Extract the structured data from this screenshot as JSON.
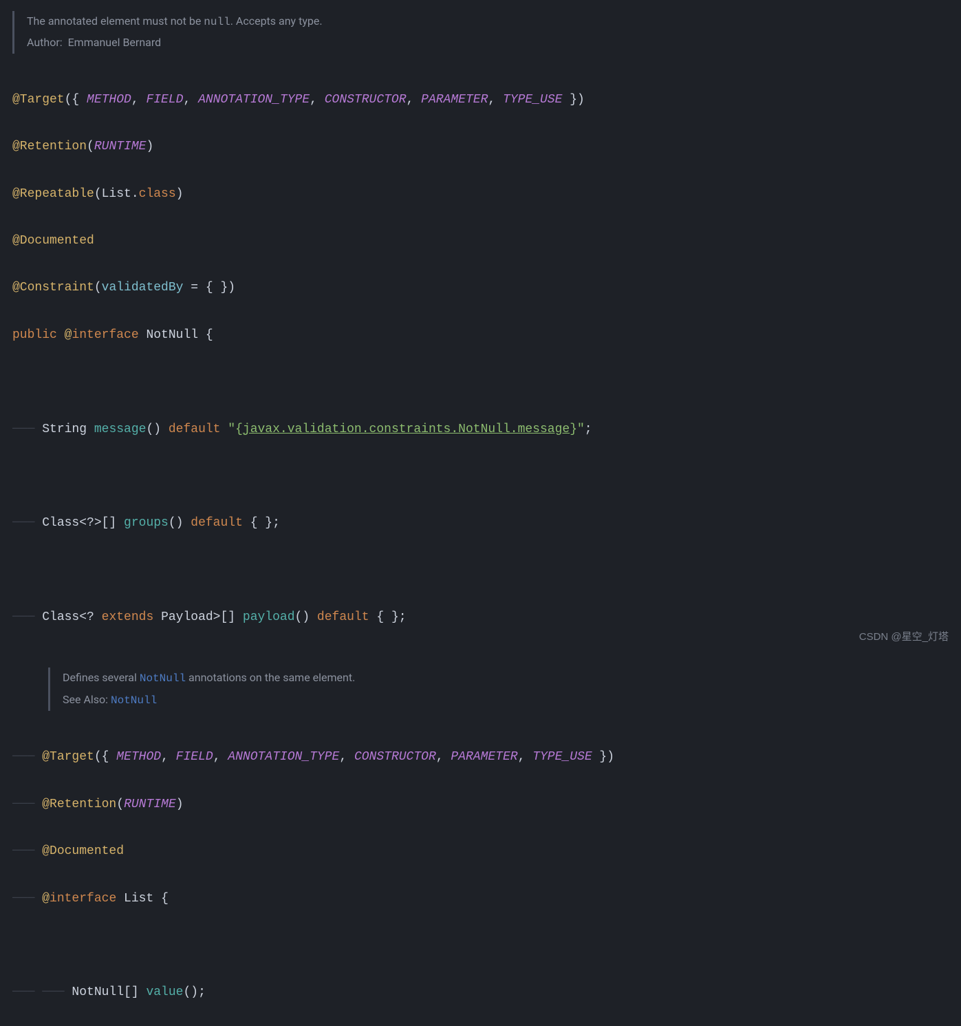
{
  "doc": {
    "line1_prefix": "The annotated element must not be ",
    "line1_code": "null",
    "line1_suffix": ". Accepts any type.",
    "author_label": "Author:",
    "author_name": "Emmanuel Bernard"
  },
  "code": {
    "l1": {
      "at": "@Target",
      "p1": "({ ",
      "v1": "METHOD",
      "c": ", ",
      "v2": "FIELD",
      "v3": "ANNOTATION_TYPE",
      "v4": "CONSTRUCTOR",
      "v5": "PARAMETER",
      "v6": "TYPE_USE",
      "p2": " })"
    },
    "l2": {
      "at": "@Retention",
      "p1": "(",
      "v": "RUNTIME",
      "p2": ")"
    },
    "l3": {
      "at": "@Repeatable",
      "p1": "(List.",
      "cls": "class",
      "p2": ")"
    },
    "l4": {
      "at": "@Documented"
    },
    "l5": {
      "at": "@Constraint",
      "p1": "(",
      "param": "validatedBy",
      "rest": " = { })"
    },
    "l6": {
      "kw1": "public",
      "at": "@",
      "kw2": "interface",
      "name": " NotNull ",
      "brace": "{"
    },
    "l7": {
      "guide": "─── ",
      "t1": "String ",
      "m": "message",
      "p": "() ",
      "def": "default",
      "s1": " \"{",
      "slink": "javax.validation.constraints.NotNull.message",
      "s2": "}\"",
      "semi": ";"
    },
    "l8": {
      "guide": "─── ",
      "t1": "Class<?>[] ",
      "m": "groups",
      "p": "() ",
      "def": "default",
      "rest": " { };"
    },
    "l9": {
      "guide": "─── ",
      "t1": "Class<? ",
      "ext": "extends",
      "t2": " Payload>[] ",
      "m": "payload",
      "p": "() ",
      "def": "default",
      "rest": " { };"
    },
    "inner_doc": {
      "line1_a": "Defines several ",
      "line1_link": "NotNull",
      "line1_b": " annotations on the same element.",
      "see_label": "See Also: ",
      "see_link": "NotNull"
    },
    "l10": {
      "guide": "─── ",
      "at": "@Target",
      "p1": "({ ",
      "v1": "METHOD",
      "c": ", ",
      "v2": "FIELD",
      "v3": "ANNOTATION_TYPE",
      "v4": "CONSTRUCTOR",
      "v5": "PARAMETER",
      "v6": "TYPE_USE",
      "p2": " })"
    },
    "l11": {
      "guide": "─── ",
      "at": "@Retention",
      "p1": "(",
      "v": "RUNTIME",
      "p2": ")"
    },
    "l12": {
      "guide": "─── ",
      "at": "@Documented"
    },
    "l13": {
      "guide": "─── ",
      "at": "@",
      "kw": "interface",
      "name": " List ",
      "brace": "{"
    },
    "l14": {
      "guide": "─── ─── ",
      "t": "NotNull[] ",
      "m": "value",
      "p": "();"
    }
  },
  "watermark": "CSDN @星空_灯塔"
}
